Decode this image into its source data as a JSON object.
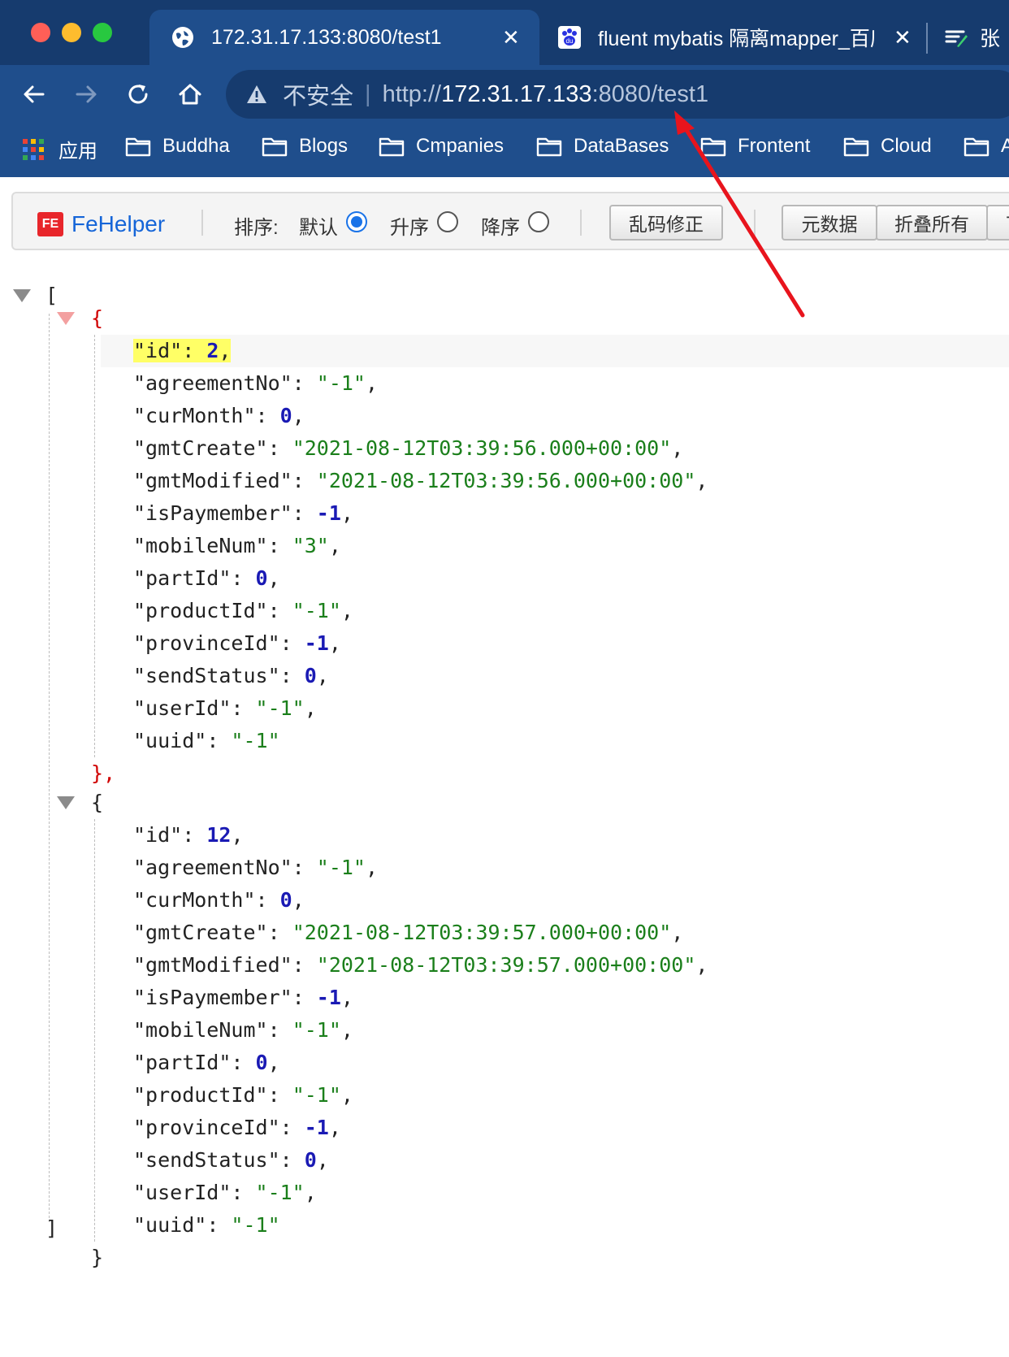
{
  "browser": {
    "tabs": [
      {
        "title": "172.31.17.133:8080/test1",
        "active": true
      },
      {
        "title": "fluent mybatis 隔离mapper_百度",
        "active": false
      },
      {
        "title": "张",
        "active": false
      }
    ],
    "close_glyph": "✕",
    "address": {
      "security_label": "不安全",
      "protocol": "http://",
      "host": "172.31.17.133",
      "path": ":8080/test1"
    },
    "bookmarks": [
      {
        "label": "应用",
        "icon": "apps-grid-icon"
      },
      {
        "label": "Buddha",
        "icon": "folder-icon"
      },
      {
        "label": "Blogs",
        "icon": "folder-icon"
      },
      {
        "label": "Cmpanies",
        "icon": "folder-icon"
      },
      {
        "label": "DataBases",
        "icon": "folder-icon"
      },
      {
        "label": "Frontent",
        "icon": "folder-icon"
      },
      {
        "label": "Cloud",
        "icon": "folder-icon"
      },
      {
        "label": "A",
        "icon": "folder-icon"
      }
    ]
  },
  "fehelper": {
    "logo_mark": "FE",
    "name": "FeHelper",
    "sort_label": "排序:",
    "sort_options": [
      {
        "label": "默认",
        "selected": true
      },
      {
        "label": "升序",
        "selected": false
      },
      {
        "label": "降序",
        "selected": false
      }
    ],
    "buttons": [
      "乱码修正",
      "元数据",
      "折叠所有",
      "下"
    ]
  },
  "json_view": {
    "open_bracket": "[",
    "close_bracket": "]",
    "records": [
      {
        "open": "{",
        "close": "},",
        "fields": [
          {
            "key": "\"id\"",
            "value": "2",
            "type": "number",
            "highlight": true
          },
          {
            "key": "\"agreementNo\"",
            "value": "\"-1\"",
            "type": "string"
          },
          {
            "key": "\"curMonth\"",
            "value": "0",
            "type": "number"
          },
          {
            "key": "\"gmtCreate\"",
            "value": "\"2021-08-12T03:39:56.000+00:00\"",
            "type": "string"
          },
          {
            "key": "\"gmtModified\"",
            "value": "\"2021-08-12T03:39:56.000+00:00\"",
            "type": "string"
          },
          {
            "key": "\"isPaymember\"",
            "value": "-1",
            "type": "number"
          },
          {
            "key": "\"mobileNum\"",
            "value": "\"3\"",
            "type": "string"
          },
          {
            "key": "\"partId\"",
            "value": "0",
            "type": "number"
          },
          {
            "key": "\"productId\"",
            "value": "\"-1\"",
            "type": "string"
          },
          {
            "key": "\"provinceId\"",
            "value": "-1",
            "type": "number"
          },
          {
            "key": "\"sendStatus\"",
            "value": "0",
            "type": "number"
          },
          {
            "key": "\"userId\"",
            "value": "\"-1\"",
            "type": "string"
          },
          {
            "key": "\"uuid\"",
            "value": "\"-1\"",
            "type": "string"
          }
        ]
      },
      {
        "open": "{",
        "close": "}",
        "fields": [
          {
            "key": "\"id\"",
            "value": "12",
            "type": "number"
          },
          {
            "key": "\"agreementNo\"",
            "value": "\"-1\"",
            "type": "string"
          },
          {
            "key": "\"curMonth\"",
            "value": "0",
            "type": "number"
          },
          {
            "key": "\"gmtCreate\"",
            "value": "\"2021-08-12T03:39:57.000+00:00\"",
            "type": "string"
          },
          {
            "key": "\"gmtModified\"",
            "value": "\"2021-08-12T03:39:57.000+00:00\"",
            "type": "string"
          },
          {
            "key": "\"isPaymember\"",
            "value": "-1",
            "type": "number"
          },
          {
            "key": "\"mobileNum\"",
            "value": "\"-1\"",
            "type": "string"
          },
          {
            "key": "\"partId\"",
            "value": "0",
            "type": "number"
          },
          {
            "key": "\"productId\"",
            "value": "\"-1\"",
            "type": "string"
          },
          {
            "key": "\"provinceId\"",
            "value": "-1",
            "type": "number"
          },
          {
            "key": "\"sendStatus\"",
            "value": "0",
            "type": "number"
          },
          {
            "key": "\"userId\"",
            "value": "\"-1\"",
            "type": "string"
          },
          {
            "key": "\"uuid\"",
            "value": "\"-1\"",
            "type": "string"
          }
        ]
      }
    ]
  },
  "colors": {
    "chrome": "#1f4e8c",
    "tabstrip": "#163b6e",
    "json_number": "#1a1ab4",
    "json_string": "#1b7f1b",
    "json_brace_active": "#d00000",
    "highlight": "#ffff66",
    "annotation_arrow": "#e8141d"
  }
}
